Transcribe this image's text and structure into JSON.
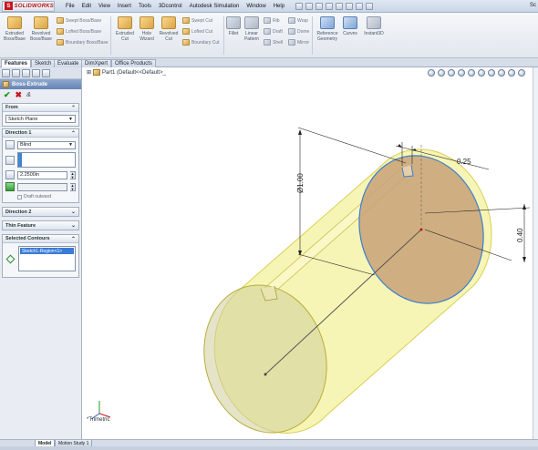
{
  "app": {
    "logo_text": "SOLIDWORKS",
    "logo_mark": "S",
    "corner": "Sc"
  },
  "menu": [
    "File",
    "Edit",
    "View",
    "Insert",
    "Tools",
    "3Dcontrol",
    "Autodesk Simulation",
    "Window",
    "Help"
  ],
  "ribbon": {
    "large": [
      {
        "label1": "Extruded",
        "label2": "Boss/Base",
        "icon": "extruded-boss-icon"
      },
      {
        "label1": "Revolved",
        "label2": "Boss/Base",
        "icon": "revolved-boss-icon"
      },
      {
        "label1": "Extruded",
        "label2": "Cut",
        "icon": "extruded-cut-icon"
      },
      {
        "label1": "Hole",
        "label2": "Wizard",
        "icon": "hole-wizard-icon"
      },
      {
        "label1": "Revolved",
        "label2": "Cut",
        "icon": "revolved-cut-icon"
      },
      {
        "label1": "Fillet",
        "label2": "",
        "icon": "fillet-icon"
      },
      {
        "label1": "Linear",
        "label2": "Pattern",
        "icon": "linear-pattern-icon"
      },
      {
        "label1": "Reference",
        "label2": "Geometry",
        "icon": "reference-geometry-icon"
      },
      {
        "label1": "Curves",
        "label2": "",
        "icon": "curves-icon"
      },
      {
        "label1": "Instant3D",
        "label2": "",
        "icon": "instant3d-icon"
      }
    ],
    "small": {
      "swept_boss": "Swept Boss/Base",
      "lofted_boss": "Lofted Boss/Base",
      "boundary_boss": "Boundary Boss/Base",
      "swept_cut": "Swept Cut",
      "lofted_cut": "Lofted Cut",
      "boundary_cut": "Boundary Cut",
      "rib": "Rib",
      "draft": "Draft",
      "shell": "Shell",
      "wrap": "Wrap",
      "dome": "Dome",
      "mirror": "Mirror"
    }
  },
  "tabs": [
    "Features",
    "Sketch",
    "Evaluate",
    "DimXpert",
    "Office Products"
  ],
  "property_manager": {
    "title": "Boss-Extrude",
    "from": {
      "header": "From",
      "value": "Sketch Plane"
    },
    "direction1": {
      "header": "Direction 1",
      "end_condition": "Blind",
      "depth": "2.2500in",
      "draft_outward": "Draft outward"
    },
    "direction2": {
      "header": "Direction 2"
    },
    "thin_feature": {
      "header": "Thin Feature"
    },
    "selected_contours": {
      "header": "Selected Contours",
      "item": "Sketch1-Region<1>"
    }
  },
  "viewport": {
    "tree": "Part1 (Default<<Default>_",
    "view_label": "*Trimetric",
    "dims": {
      "diameter": "Ø1.00",
      "width": "0.25",
      "height": "0.40"
    }
  },
  "bottom_tabs": [
    "Model",
    "Motion Study 1"
  ],
  "colors": {
    "body_fill": "#f6f3a8",
    "face_fill": "#c8a178",
    "dimension": "#222222",
    "accent": "#3b7bd4"
  }
}
